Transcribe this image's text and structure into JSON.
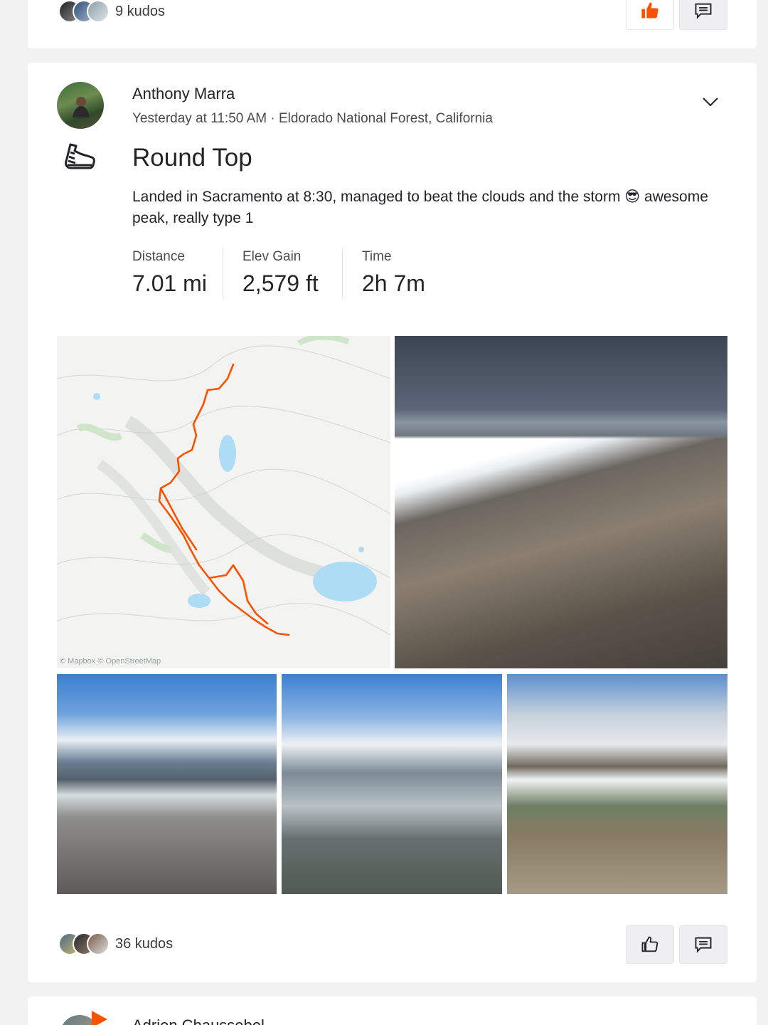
{
  "previous_post": {
    "kudos_text": "9 kudos"
  },
  "post": {
    "author_name": "Anthony Marra",
    "meta": "Yesterday at 11:50 AM · Eldorado National Forest, California",
    "activity_icon": "hiking-shoe-icon",
    "title": "Round Top",
    "description": "Landed in Sacramento at 8:30, managed to beat the clouds and the storm 😎 awesome peak, really type 1",
    "stats": [
      {
        "label": "Distance",
        "value": "7.01 mi"
      },
      {
        "label": "Elev Gain",
        "value": "2,579 ft"
      },
      {
        "label": "Time",
        "value": "2h 7m"
      }
    ],
    "map_attribution": "© Mapbox © OpenStreetMap",
    "kudos_text": "36 kudos"
  },
  "next_post": {
    "author_name": "Adrien Chaussebel"
  },
  "colors": {
    "brand_orange": "#fc5200",
    "page_bg": "#f2f2f2",
    "card_bg": "#ffffff",
    "route": "#fc5200",
    "lake": "#aedcf5"
  }
}
